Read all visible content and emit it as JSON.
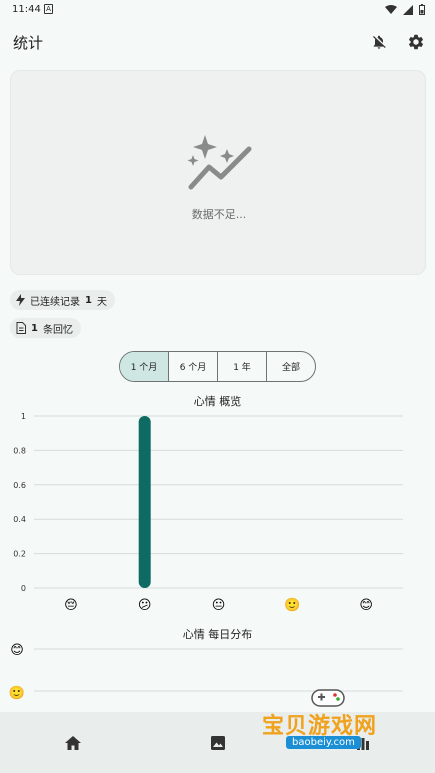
{
  "status_bar": {
    "time": "11:44",
    "notification_icon_letter": "A"
  },
  "app_bar": {
    "title": "统计"
  },
  "empty_card": {
    "message": "数据不足..."
  },
  "streak_chip": {
    "prefix": "已连续记录",
    "count": "1",
    "suffix": "天"
  },
  "memories_chip": {
    "count": "1",
    "suffix": "条回忆"
  },
  "range_selector": {
    "options": [
      "1 个月",
      "6 个月",
      "1 年",
      "全部"
    ],
    "selected": "1 个月"
  },
  "mood_overview": {
    "title": "心情 概览",
    "chart_data": {
      "type": "bar",
      "categories": [
        "😔",
        "😕",
        "😐",
        "🙂",
        "😊"
      ],
      "values": [
        0,
        1,
        0,
        0,
        0
      ],
      "ylim": [
        0,
        1
      ],
      "yticks": [
        "0",
        "0.2",
        "0.4",
        "0.6",
        "0.8",
        "1"
      ],
      "grid": true,
      "bar_color": "#0e6b63"
    }
  },
  "daily_distribution": {
    "title": "心情 每日分布",
    "row_emojis": [
      "😊",
      "🙂"
    ]
  },
  "watermark": {
    "text": "宝贝游戏网",
    "url": "baobeiy.com"
  },
  "colors": {
    "accent": "#0e6b63",
    "selected_segment": "#cfe7e3",
    "background": "#f5faf8"
  }
}
